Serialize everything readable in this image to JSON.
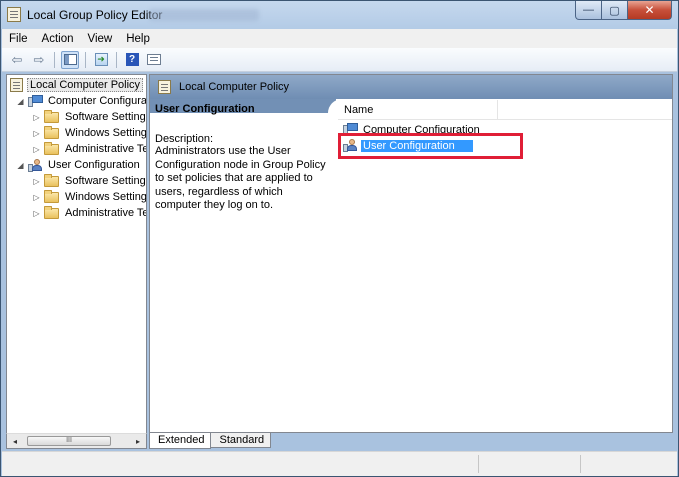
{
  "window": {
    "title": "Local Group Policy Editor",
    "controls": {
      "minimize": "—",
      "maximize": "▢",
      "close": "✕"
    }
  },
  "menu": [
    "File",
    "Action",
    "View",
    "Help"
  ],
  "toolbar": {
    "buttons": [
      {
        "name": "back",
        "icon": "arrow-left-icon",
        "glyph": "⇦"
      },
      {
        "name": "forward",
        "icon": "arrow-right-icon",
        "glyph": "⇨"
      },
      {
        "name": "show-hide-tree",
        "icon": "console-tree-icon"
      },
      {
        "name": "export-list",
        "icon": "export-list-icon",
        "glyph": "➜"
      },
      {
        "name": "help",
        "icon": "help-icon",
        "glyph": "?"
      },
      {
        "name": "properties",
        "icon": "properties-icon"
      }
    ]
  },
  "tree": {
    "root": "Local Computer Policy",
    "computer": {
      "label": "Computer Configura",
      "children": [
        "Software Settings",
        "Windows Setting",
        "Administrative Te"
      ]
    },
    "user": {
      "label": "User Configuration",
      "children": [
        "Software Settings",
        "Windows Setting",
        "Administrative Te"
      ]
    },
    "expand_open": "◢",
    "expand_closed": "▷"
  },
  "scrollbar": {
    "left": "◂",
    "right": "▸",
    "thumb": "III"
  },
  "right_pane": {
    "header": "Local Computer Policy",
    "description": {
      "title": "User Configuration",
      "label": "Description:",
      "body": "Administrators use the User Configuration node in Group Policy to set policies that are applied to users, regardless of which computer they log on to."
    },
    "list": {
      "column": "Name",
      "rows": [
        "Computer Configuration",
        "User Configuration"
      ],
      "selected_index": 1
    }
  },
  "tabs": [
    "Extended",
    "Standard"
  ],
  "colors": {
    "selection": "#3399ff",
    "highlight": "#e01e36",
    "header": "#7290b5"
  }
}
